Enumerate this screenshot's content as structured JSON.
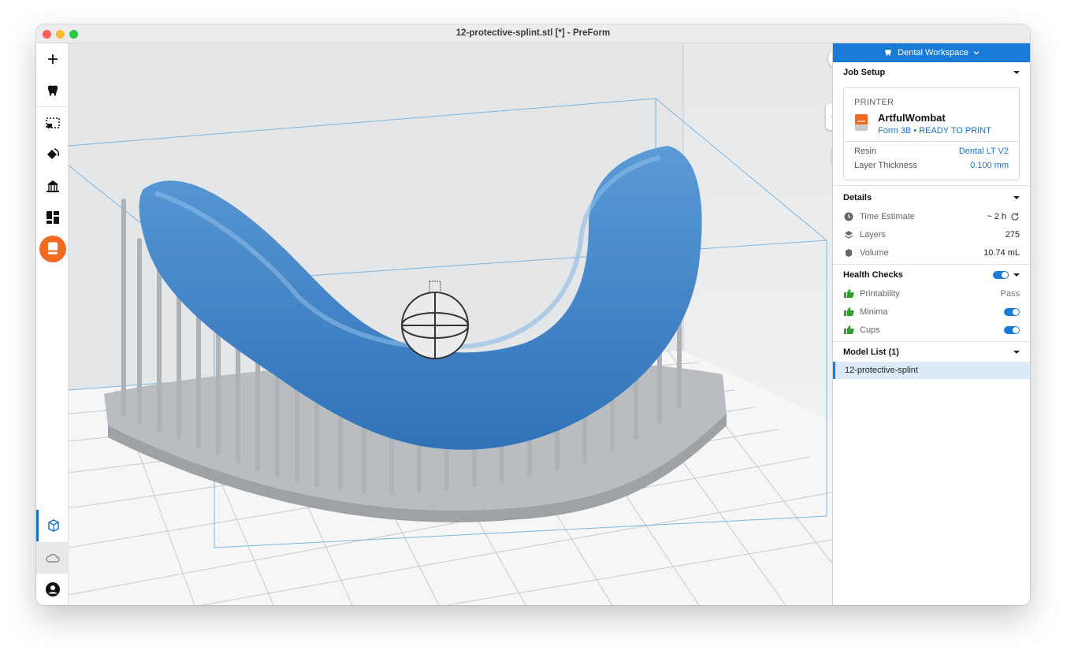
{
  "window": {
    "title": "12-protective-splint.stl [*] - PreForm"
  },
  "toolbar": {
    "tools": [
      {
        "name": "add-icon"
      },
      {
        "name": "tooth-icon"
      },
      {
        "name": "select-icon"
      },
      {
        "name": "orient-icon"
      },
      {
        "name": "supports-icon"
      },
      {
        "name": "layout-icon"
      },
      {
        "name": "print-icon",
        "accent": "#f26a21"
      }
    ],
    "bottom": [
      {
        "name": "scene-icon"
      },
      {
        "name": "cloud-icon"
      },
      {
        "name": "account-icon"
      }
    ]
  },
  "panel": {
    "workspace": "Dental Workspace",
    "job_setup": {
      "title": "Job Setup",
      "printer_label": "PRINTER",
      "printer_name": "ArtfulWombat",
      "printer_status": "Form 3B • READY TO PRINT",
      "resin_label": "Resin",
      "resin_value": "Dental LT V2",
      "layer_label": "Layer Thickness",
      "layer_value": "0.100 mm"
    },
    "details": {
      "title": "Details",
      "time_label": "Time Estimate",
      "time_value": "~ 2 h",
      "layers_label": "Layers",
      "layers_value": "275",
      "volume_label": "Volume",
      "volume_value": "10.74 mL"
    },
    "health": {
      "title": "Health Checks",
      "printability_label": "Printability",
      "printability_value": "Pass",
      "minima_label": "Minima",
      "cups_label": "Cups"
    },
    "models": {
      "title": "Model List (1)",
      "items": [
        "12-protective-splint"
      ]
    }
  },
  "colors": {
    "accent": "#1a7bd6",
    "print": "#f26a21",
    "model": "#3f86c8",
    "support": "#b9bcc0",
    "ok": "#2e9e2e"
  }
}
